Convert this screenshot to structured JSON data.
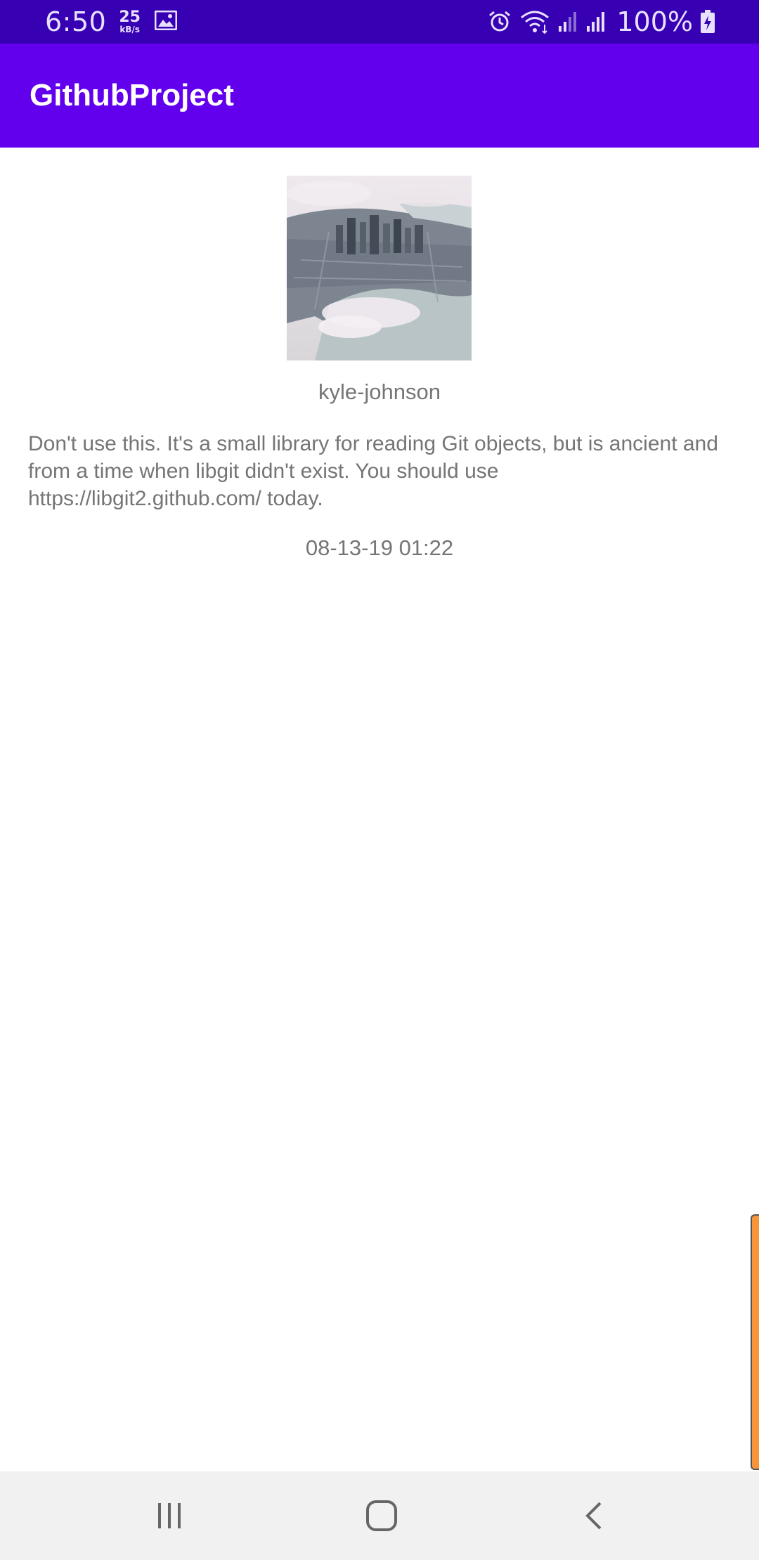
{
  "status_bar": {
    "time": "6:50",
    "net_speed_value": "25",
    "net_speed_unit": "kB/s",
    "battery": "100%",
    "icons": [
      "gallery-icon",
      "alarm-icon",
      "wifi-icon",
      "signal-icon",
      "signal-icon",
      "battery-charging-icon"
    ]
  },
  "app_bar": {
    "title": "GithubProject"
  },
  "repo": {
    "avatar_icon": "avatar-image",
    "owner": "kyle-johnson",
    "description": "Don't use this. It's a small library for reading Git objects, but is ancient and from a time when libgit didn't exist. You should use https://libgit2.github.com/ today.",
    "date": "08-13-19 01:22"
  },
  "nav_bar": {
    "icons": [
      "recent-apps-icon",
      "home-icon",
      "back-icon"
    ]
  },
  "colors": {
    "status_bar": "#3700b3",
    "app_bar": "#6200ee",
    "text_secondary": "#757575",
    "scroll_indicator": "#f7953a",
    "nav_bar": "#f1f1f1"
  }
}
